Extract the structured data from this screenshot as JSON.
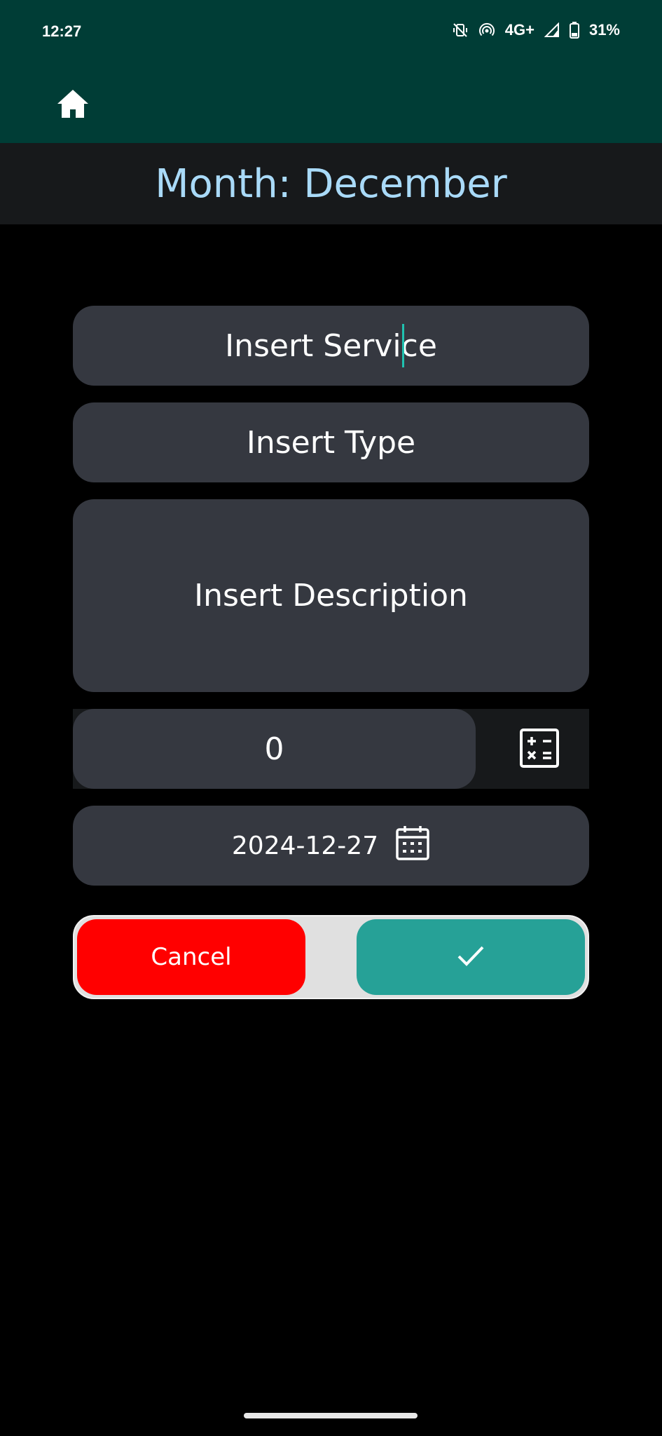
{
  "status_bar": {
    "time": "12:27",
    "network": "4G+",
    "battery": "31%",
    "icons": [
      "vibrate-off-icon",
      "hotspot-icon",
      "signal-icon",
      "battery-icon"
    ]
  },
  "app_bar": {
    "home_icon": "home-icon"
  },
  "header": {
    "title": "Month: December"
  },
  "form": {
    "service_placeholder": "Insert Service",
    "type_placeholder": "Insert Type",
    "description_placeholder": "Insert Description",
    "amount_value": "0",
    "calculator_icon": "calculator-icon",
    "date_value": "2024-12-27",
    "calendar_icon": "calendar-icon"
  },
  "actions": {
    "cancel_label": "Cancel",
    "confirm_icon": "checkmark-icon"
  },
  "colors": {
    "app_bar": "#003d36",
    "header_bg": "#17191b",
    "title_text": "#a9daf8",
    "field_bg": "#353840",
    "cancel": "#ff0000",
    "confirm": "#26a197",
    "cursor": "#20c2b0"
  }
}
